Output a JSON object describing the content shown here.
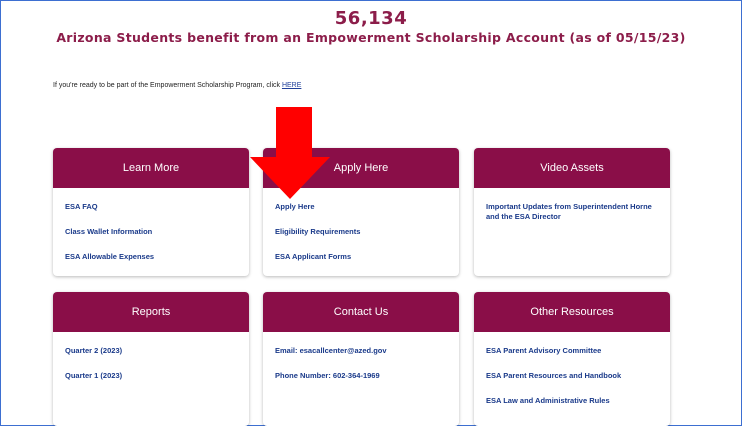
{
  "stat": {
    "number": "56,134",
    "caption": "Arizona Students benefit from an Empowerment Scholarship Account (as of 05/15/23)"
  },
  "intro": {
    "text": "If you're ready to be part of the Empowerment Scholarship Program, click ",
    "link": "HERE"
  },
  "cards": {
    "learn_more": {
      "title": "Learn More",
      "links": [
        "ESA FAQ",
        "Class Wallet Information",
        "ESA Allowable Expenses"
      ]
    },
    "apply_here": {
      "title": "Apply Here",
      "links": [
        "Apply Here",
        "Eligibility Requirements",
        "ESA Applicant Forms"
      ]
    },
    "video_assets": {
      "title": "Video Assets",
      "links": [
        "Important Updates from Superintendent Horne and the ESA Director"
      ]
    },
    "reports": {
      "title": "Reports",
      "links": [
        "Quarter 2 (2023)",
        "Quarter 1 (2023)"
      ]
    },
    "contact_us": {
      "title": "Contact Us",
      "links": [
        "Email: esacallcenter@azed.gov",
        "Phone Number: 602-364-1969"
      ]
    },
    "other_resources": {
      "title": "Other Resources",
      "links": [
        "ESA Parent Advisory Committee",
        "ESA Parent Resources and Handbook",
        "ESA Law and Administrative Rules"
      ]
    }
  },
  "colors": {
    "brand": "#8a0e48",
    "link": "#1a3a8a",
    "arrow": "#ff0000"
  },
  "annotation": {
    "icon": "red-down-arrow-icon"
  }
}
